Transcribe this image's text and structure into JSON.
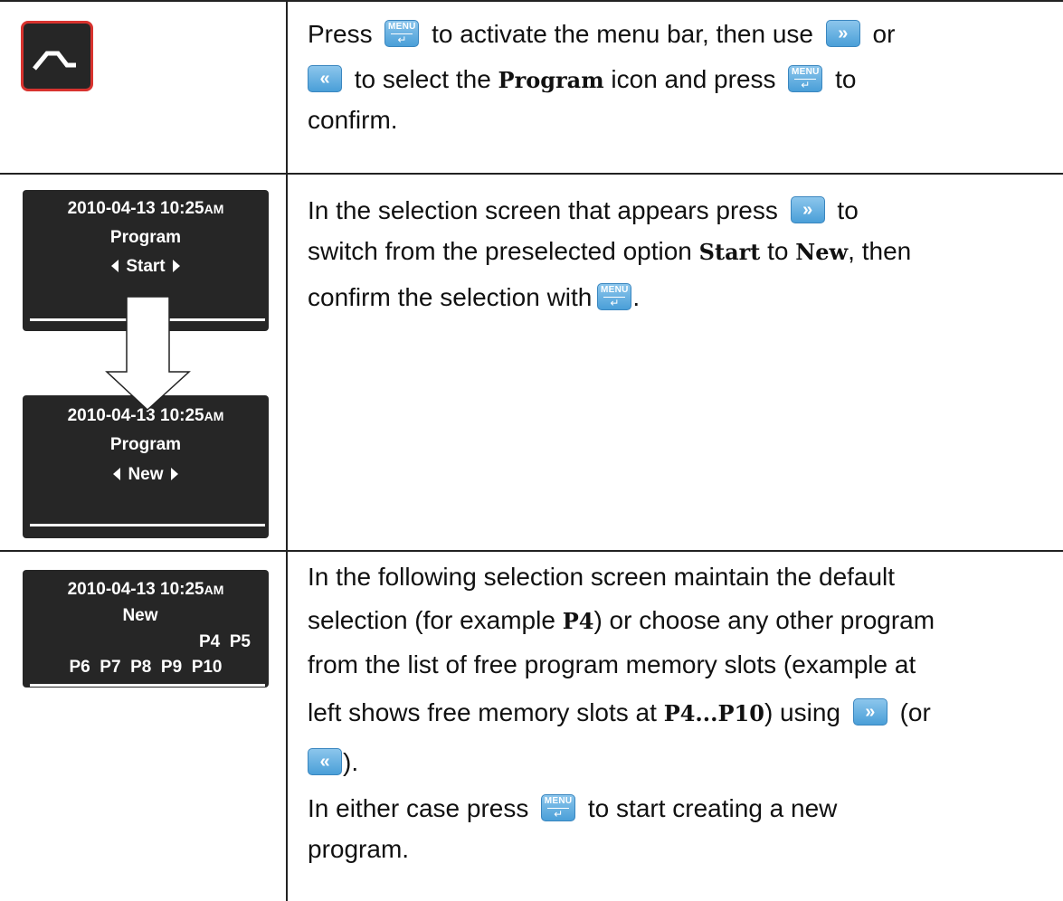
{
  "row1": {
    "lines": [
      [
        "Press",
        "to activate the menu bar, then use",
        "or"
      ],
      [
        "to select the",
        "Program",
        "icon and press",
        "to"
      ],
      [
        "confirm."
      ]
    ]
  },
  "row2": {
    "screen_top": {
      "datetime": "2010-04-13  10:25",
      "ampm": "AM",
      "title": "Program",
      "option": "Start"
    },
    "screen_bottom": {
      "datetime": "2010-04-13  10:25",
      "ampm": "AM",
      "title": "Program",
      "option": "New"
    },
    "lines": [
      [
        "In the selection screen that appears press",
        "to"
      ],
      [
        "switch from the preselected option",
        "Start",
        "to",
        "New",
        ", then"
      ],
      [
        "confirm the selection with",
        "."
      ]
    ]
  },
  "row3": {
    "screen": {
      "datetime": "2010-04-13  10:25",
      "ampm": "AM",
      "title": "New",
      "slots_row1": "P4  P5",
      "slots_row2": "P6  P7  P8  P9  P10"
    },
    "lines": [
      [
        "In the following selection screen maintain the default"
      ],
      [
        "selection (for example",
        "P4",
        ") or choose any other program"
      ],
      [
        "from the list of free program memory slots (example at"
      ],
      [
        "left shows free memory slots at",
        "P4...P10",
        ") using",
        "(or"
      ],
      [
        ")."
      ],
      [
        "In either case press",
        "to start creating a new"
      ],
      [
        "program."
      ]
    ]
  },
  "keys": {
    "menu_label": "MENU",
    "menu_symbol": "↵",
    "right_symbol": "»",
    "left_symbol": "«"
  },
  "colors": {
    "key_blue": "#4a9fd8",
    "icon_border_red": "#d8332f",
    "screen_bg": "#262626"
  },
  "icons": {
    "program": "program-ramp-icon",
    "menu_key": "menu-enter-key-icon",
    "right_key": "right-arrow-key-icon",
    "left_key": "left-arrow-key-icon",
    "transition": "down-arrow-icon"
  }
}
